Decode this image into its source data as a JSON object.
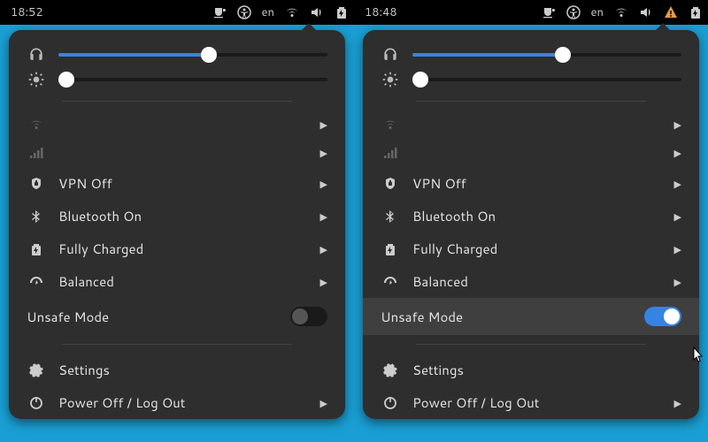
{
  "left": {
    "clock": "18:52",
    "lang": "en",
    "volume_percent": 56,
    "brightness_percent": 3,
    "rows": {
      "vpn": "VPN Off",
      "bluetooth": "Bluetooth On",
      "battery": "Fully Charged",
      "power_mode": "Balanced",
      "unsafe": "Unsafe Mode",
      "settings": "Settings",
      "poweroff": "Power Off / Log Out"
    },
    "unsafe_on": false,
    "warning_icon": false
  },
  "right": {
    "clock": "18:48",
    "lang": "en",
    "volume_percent": 56,
    "brightness_percent": 3,
    "rows": {
      "vpn": "VPN Off",
      "bluetooth": "Bluetooth On",
      "battery": "Fully Charged",
      "power_mode": "Balanced",
      "unsafe": "Unsafe Mode",
      "settings": "Settings",
      "poweroff": "Power Off / Log Out"
    },
    "unsafe_on": true,
    "warning_icon": true
  },
  "colors": {
    "accent": "#3584e4"
  }
}
